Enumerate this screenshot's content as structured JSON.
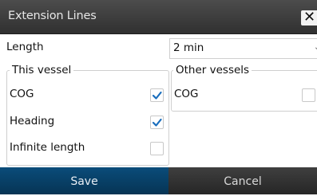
{
  "dialog": {
    "title": "Extension Lines",
    "close_icon": "close-icon"
  },
  "length": {
    "label": "Length",
    "value": "2 min",
    "icon": "chevron-down-icon"
  },
  "this_vessel": {
    "title": "This vessel",
    "items": [
      {
        "label": "COG",
        "checked": true
      },
      {
        "label": "Heading",
        "checked": true
      },
      {
        "label": "Infinite length",
        "checked": false
      }
    ]
  },
  "other_vessels": {
    "title": "Other vessels",
    "items": [
      {
        "label": "COG",
        "checked": false
      }
    ]
  },
  "footer": {
    "save_label": "Save",
    "cancel_label": "Cancel"
  },
  "colors": {
    "check": "#1a6ebd",
    "save_bg": "#0a4c7a",
    "cancel_bg": "#2f2f2f",
    "titlebar_bg": "#3a3a3a"
  }
}
